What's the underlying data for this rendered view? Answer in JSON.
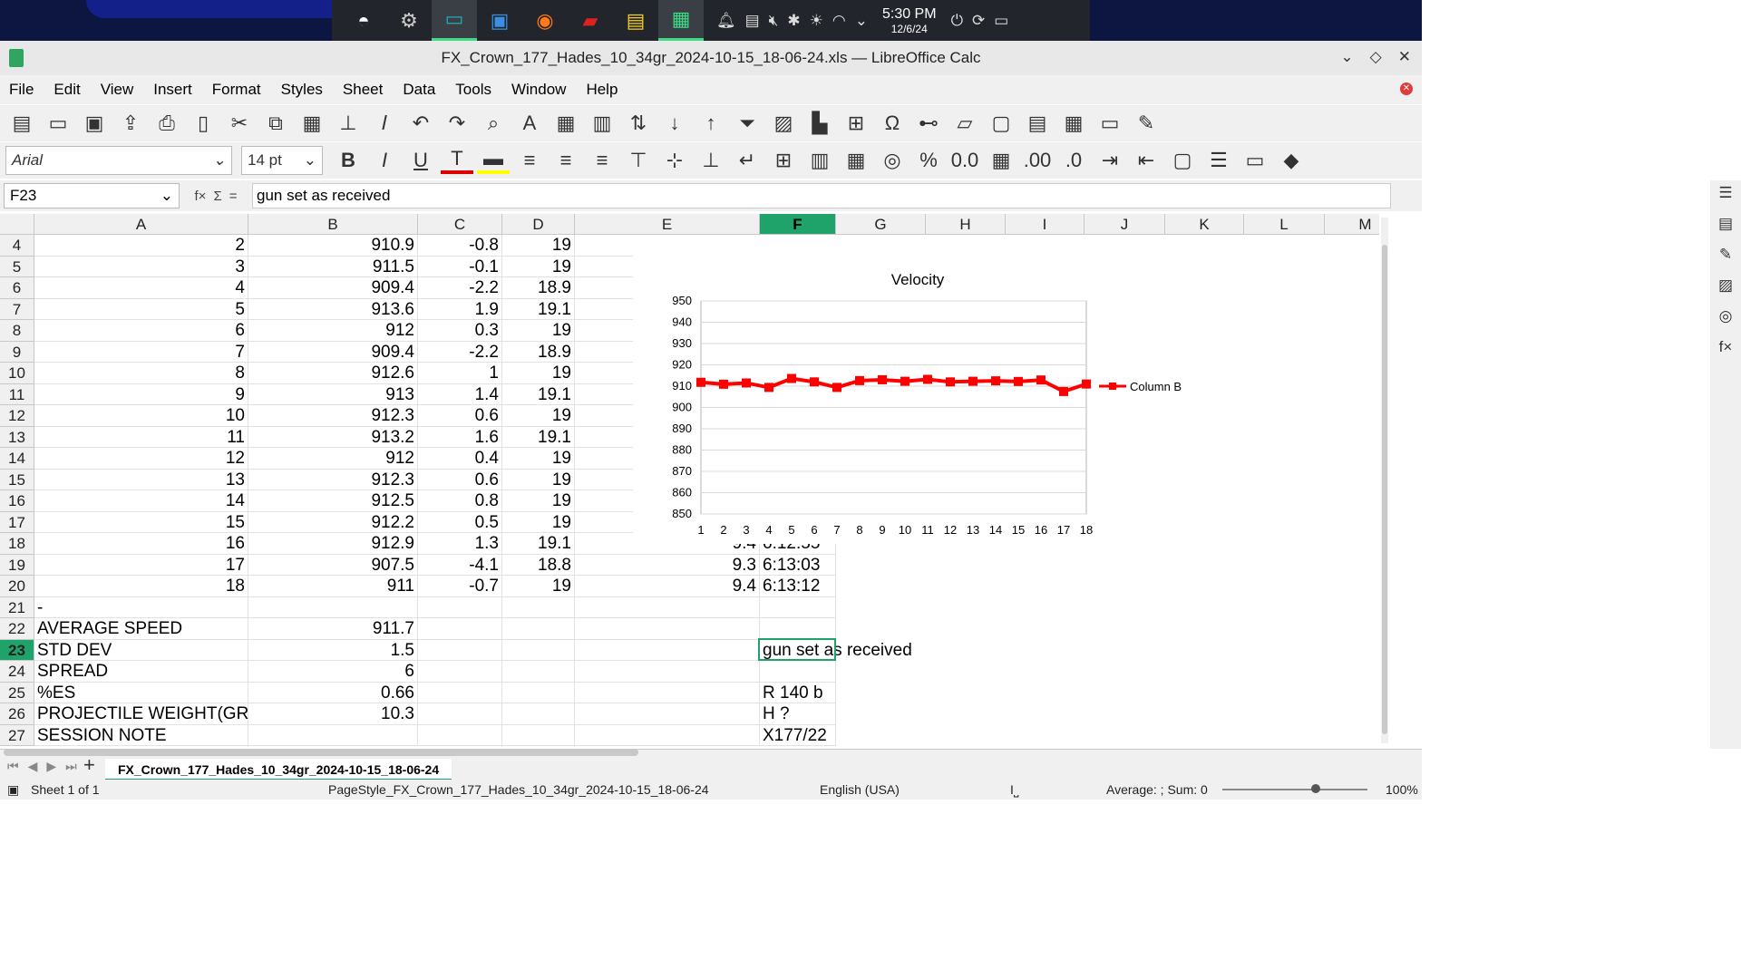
{
  "taskbar": {
    "time": "5:30 PM",
    "date": "12/6/24",
    "apps": [
      {
        "name": "plasma-launcher-icon",
        "glyph": "◓"
      },
      {
        "name": "settings-icon",
        "glyph": "⚙"
      },
      {
        "name": "terminal-icon",
        "glyph": "▭"
      },
      {
        "name": "store-icon",
        "glyph": "▣"
      },
      {
        "name": "firefox-icon",
        "glyph": "◉"
      },
      {
        "name": "book-icon",
        "glyph": "▰"
      },
      {
        "name": "notes-icon",
        "glyph": "▤"
      },
      {
        "name": "calc-icon",
        "glyph": "▦"
      }
    ]
  },
  "window": {
    "title": "FX_Crown_177_Hades_10_34gr_2024-10-15_18-06-24.xls — LibreOffice Calc"
  },
  "menu": [
    "File",
    "Edit",
    "View",
    "Insert",
    "Format",
    "Styles",
    "Sheet",
    "Data",
    "Tools",
    "Window",
    "Help"
  ],
  "format": {
    "font_name": "Arial",
    "font_size": "14 pt"
  },
  "formula_bar": {
    "cell_ref": "F23",
    "content": "gun set as received"
  },
  "columns": [
    "A",
    "B",
    "C",
    "D",
    "E",
    "F",
    "G",
    "H",
    "I",
    "J",
    "K",
    "L",
    "M"
  ],
  "rows": [
    {
      "n": "4",
      "A": "2",
      "B": "910.9",
      "C": "-0.8",
      "D": "19"
    },
    {
      "n": "5",
      "A": "3",
      "B": "911.5",
      "C": "-0.1",
      "D": "19"
    },
    {
      "n": "6",
      "A": "4",
      "B": "909.4",
      "C": "-2.2",
      "D": "18.9"
    },
    {
      "n": "7",
      "A": "5",
      "B": "913.6",
      "C": "1.9",
      "D": "19.1"
    },
    {
      "n": "8",
      "A": "6",
      "B": "912",
      "C": "0.3",
      "D": "19"
    },
    {
      "n": "9",
      "A": "7",
      "B": "909.4",
      "C": "-2.2",
      "D": "18.9"
    },
    {
      "n": "10",
      "A": "8",
      "B": "912.6",
      "C": "1",
      "D": "19"
    },
    {
      "n": "11",
      "A": "9",
      "B": "913",
      "C": "1.4",
      "D": "19.1"
    },
    {
      "n": "12",
      "A": "10",
      "B": "912.3",
      "C": "0.6",
      "D": "19"
    },
    {
      "n": "13",
      "A": "11",
      "B": "913.2",
      "C": "1.6",
      "D": "19.1"
    },
    {
      "n": "14",
      "A": "12",
      "B": "912",
      "C": "0.4",
      "D": "19"
    },
    {
      "n": "15",
      "A": "13",
      "B": "912.3",
      "C": "0.6",
      "D": "19"
    },
    {
      "n": "16",
      "A": "14",
      "B": "912.5",
      "C": "0.8",
      "D": "19"
    },
    {
      "n": "17",
      "A": "15",
      "B": "912.2",
      "C": "0.5",
      "D": "19"
    },
    {
      "n": "18",
      "A": "16",
      "B": "912.9",
      "C": "1.3",
      "D": "19.1",
      "E": "9.4",
      "F": "6:12:55"
    },
    {
      "n": "19",
      "A": "17",
      "B": "907.5",
      "C": "-4.1",
      "D": "18.8",
      "E": "9.3",
      "F": "6:13:03"
    },
    {
      "n": "20",
      "A": "18",
      "B": "911",
      "C": "-0.7",
      "D": "19",
      "E": "9.4",
      "F": "6:13:12"
    },
    {
      "n": "21",
      "A": "-"
    },
    {
      "n": "22",
      "A": "AVERAGE SPEED",
      "B": "911.7"
    },
    {
      "n": "23",
      "A": "STD DEV",
      "B": "1.5",
      "F": "gun set as received"
    },
    {
      "n": "24",
      "A": "SPREAD",
      "B": "6"
    },
    {
      "n": "25",
      "A": "%ES",
      "B": "0.66",
      "F": "R 140 b"
    },
    {
      "n": "26",
      "A": "PROJECTILE WEIGHT(GR",
      "B": "10.3",
      "F": "H ?"
    },
    {
      "n": "27",
      "A": "SESSION NOTE",
      "F": "X177/22"
    }
  ],
  "chart_data": {
    "type": "line",
    "title": "Velocity",
    "x": [
      1,
      2,
      3,
      4,
      5,
      6,
      7,
      8,
      9,
      10,
      11,
      12,
      13,
      14,
      15,
      16,
      17,
      18
    ],
    "series": [
      {
        "name": "Column B",
        "values": [
          911.8,
          910.9,
          911.5,
          909.4,
          913.6,
          912,
          909.4,
          912.6,
          913,
          912.3,
          913.2,
          912,
          912.3,
          912.5,
          912.2,
          912.9,
          907.5,
          911
        ],
        "color": "#ff0000"
      }
    ],
    "ylim": [
      850,
      950
    ],
    "yticks": [
      850,
      860,
      870,
      880,
      890,
      900,
      910,
      920,
      930,
      940,
      950
    ],
    "grid": true,
    "legend": "right"
  },
  "sheet_tab": "FX_Crown_177_Hades_10_34gr_2024-10-15_18-06-24",
  "status": {
    "sheet": "Sheet 1 of 1",
    "page_style": "PageStyle_FX_Crown_177_Hades_10_34gr_2024-10-15_18-06-24",
    "language": "English (USA)",
    "summary": "Average: ; Sum: 0",
    "zoom": "100%"
  }
}
